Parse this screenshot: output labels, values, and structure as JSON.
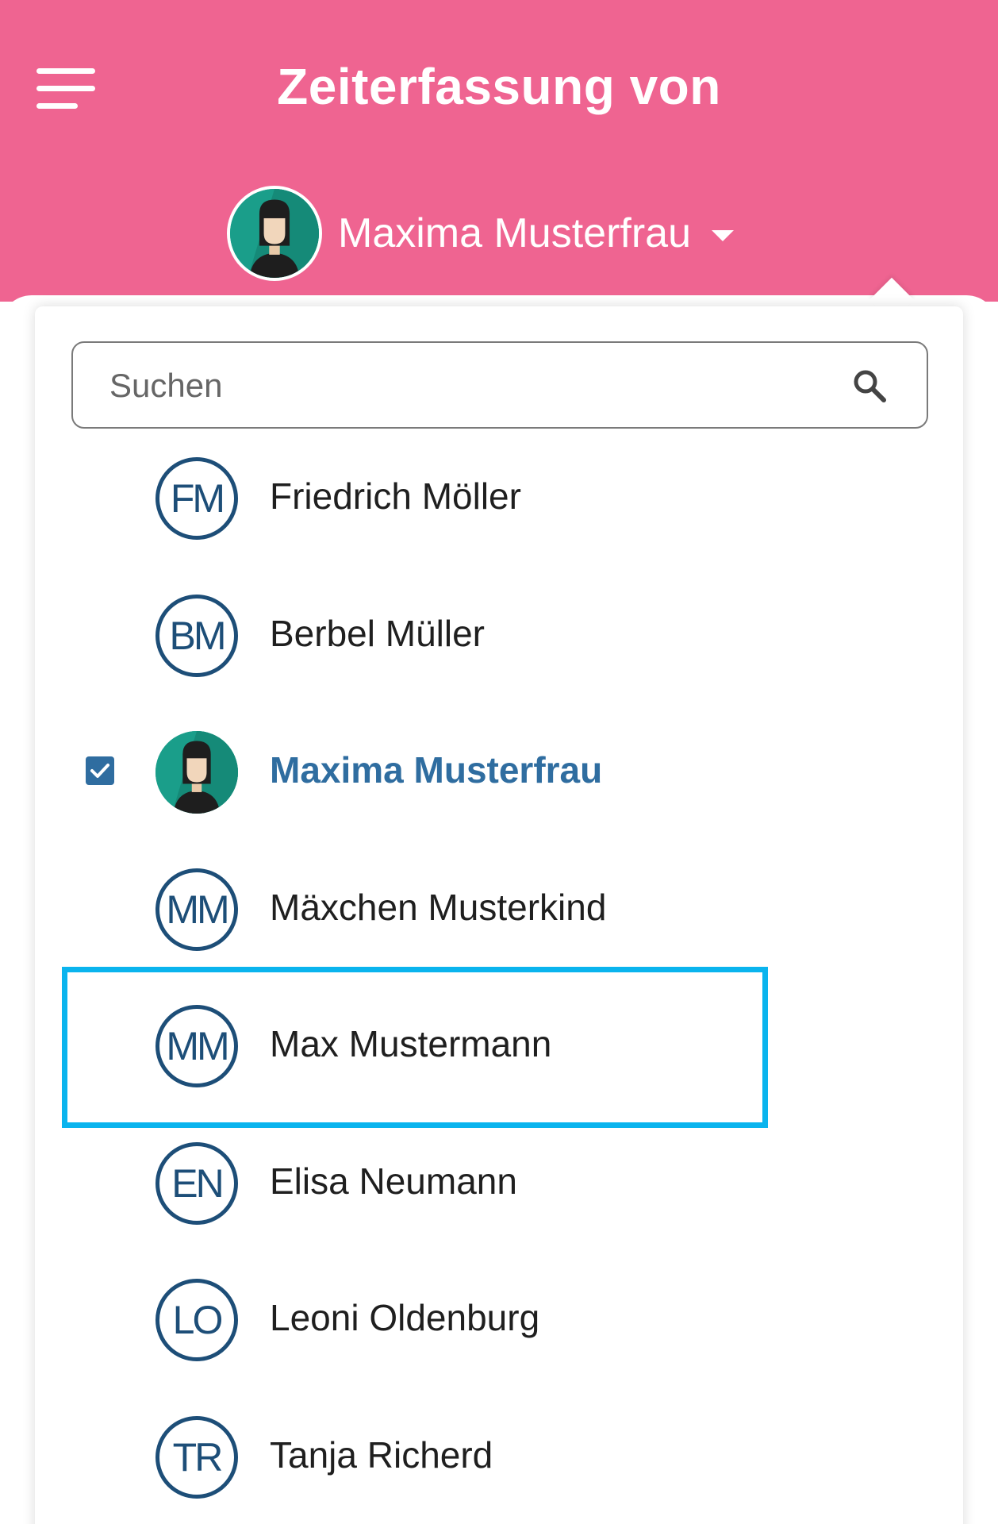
{
  "header": {
    "title": "Zeiterfassung von",
    "current_user": "Maxima Musterfrau",
    "background_color": "#ef6491"
  },
  "search": {
    "placeholder": "Suchen",
    "value": ""
  },
  "users": [
    {
      "initials": "FM",
      "name": "Friedrich Möller",
      "selected": false
    },
    {
      "initials": "BM",
      "name": "Berbel Müller",
      "selected": false
    },
    {
      "initials": "",
      "name": "Maxima Musterfrau",
      "selected": true,
      "avatar": "photo"
    },
    {
      "initials": "MM",
      "name": "Mäxchen Musterkind",
      "selected": false
    },
    {
      "initials": "MM",
      "name": "Max Mustermann",
      "selected": false,
      "highlighted": true
    },
    {
      "initials": "EN",
      "name": "Elisa Neumann",
      "selected": false
    },
    {
      "initials": "LO",
      "name": "Leoni Oldenburg",
      "selected": false
    },
    {
      "initials": "TR",
      "name": "Tanja Richerd",
      "selected": false
    }
  ],
  "colors": {
    "accent": "#2f6da0",
    "avatar_ring": "#1d4e78",
    "highlight": "#0ab4ee"
  },
  "icons": {
    "menu": "hamburger-menu-icon",
    "dropdown": "caret-down-icon",
    "search": "search-icon",
    "check": "checkbox-checked-icon"
  }
}
